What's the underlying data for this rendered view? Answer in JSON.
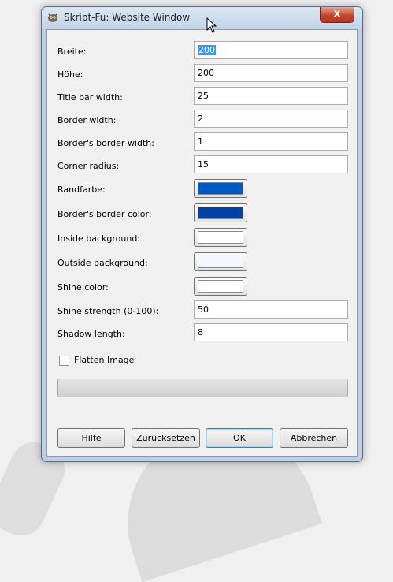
{
  "window": {
    "title": "Skript-Fu: Website Window",
    "close_label": "x"
  },
  "fields": [
    {
      "label": "Breite:",
      "value": "200",
      "selected": true
    },
    {
      "label": "Höhe:",
      "value": "200"
    },
    {
      "label": "Title bar width:",
      "value": "25"
    },
    {
      "label": "Border width:",
      "value": "2"
    },
    {
      "label": "Border's border width:",
      "value": "1"
    },
    {
      "label": "Corner radius:",
      "value": "15"
    },
    {
      "label": "Shine strength (0-100):",
      "value": "50"
    },
    {
      "label": "Shadow length:",
      "value": "8"
    }
  ],
  "colors": [
    {
      "label": "Randfarbe:",
      "color": "#005ac6"
    },
    {
      "label": "Border's border color:",
      "color": "#0043a2"
    },
    {
      "label": "Inside background:",
      "color": "#ffffff"
    },
    {
      "label": "Outside background:",
      "color": "#f3f7ff"
    },
    {
      "label": "Shine color:",
      "color": "#ffffff"
    }
  ],
  "flatten": {
    "label": "Flatten Image",
    "checked": false
  },
  "buttons": {
    "help": {
      "prefix": "",
      "mnemonic": "H",
      "rest": "ilfe"
    },
    "reset": {
      "prefix": "",
      "mnemonic": "Z",
      "rest": "urücksetzen"
    },
    "ok": {
      "prefix": "",
      "mnemonic": "O",
      "rest": "K"
    },
    "cancel": {
      "prefix": "",
      "mnemonic": "A",
      "rest": "bbrechen"
    }
  }
}
